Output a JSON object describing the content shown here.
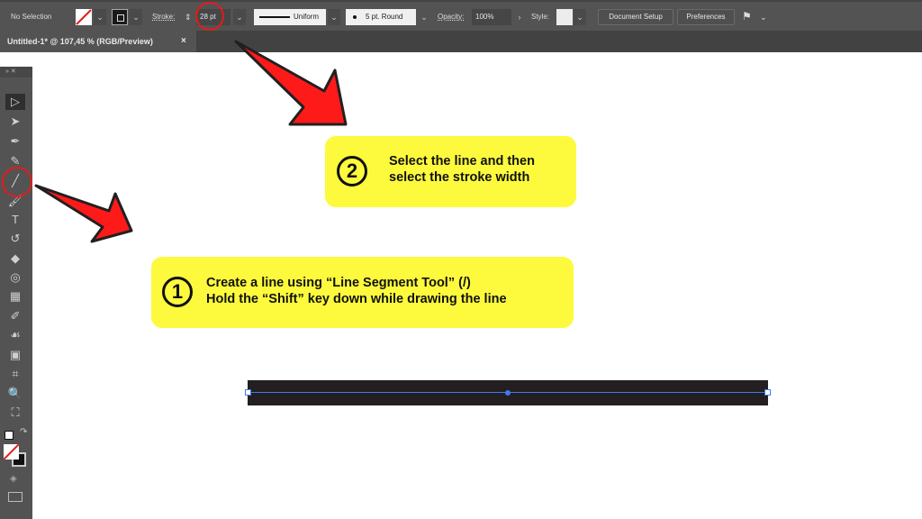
{
  "control_bar": {
    "selection_status": "No Selection",
    "stroke_label": "Stroke:",
    "stroke_value": "28 pt",
    "profile_label": "Uniform",
    "brush_label": "5 pt. Round",
    "opacity_label": "Opacity:",
    "opacity_value": "100%",
    "style_label": "Style:",
    "document_setup_button": "Document Setup",
    "preferences_button": "Preferences"
  },
  "document_tab": {
    "title": "Untitled-1* @ 107,45 % (RGB/Preview)",
    "close": "×"
  },
  "toolbar": {
    "header": "» ✕",
    "tools": [
      {
        "name": "selection-tool",
        "glyph": "▷"
      },
      {
        "name": "direct-selection-tool",
        "glyph": "➤"
      },
      {
        "name": "pen-tool",
        "glyph": "✒"
      },
      {
        "name": "curvature-tool",
        "glyph": "✎"
      },
      {
        "name": "line-segment-tool",
        "glyph": "╱"
      },
      {
        "name": "paintbrush-tool",
        "glyph": "🖌"
      },
      {
        "name": "type-tool",
        "glyph": "T"
      },
      {
        "name": "rotate-tool",
        "glyph": "↺"
      },
      {
        "name": "eraser-tool",
        "glyph": "◆"
      },
      {
        "name": "shape-builder-tool",
        "glyph": "◎"
      },
      {
        "name": "gradient-tool",
        "glyph": "▦"
      },
      {
        "name": "eyedropper-tool",
        "glyph": "✐"
      },
      {
        "name": "puppet-warp-tool",
        "glyph": "☙"
      },
      {
        "name": "live-paint-tool",
        "glyph": "▣"
      },
      {
        "name": "artboard-tool",
        "glyph": "⌗"
      },
      {
        "name": "zoom-tool",
        "glyph": "🔍"
      },
      {
        "name": "free-transform-tool",
        "glyph": "⛶"
      }
    ]
  },
  "callouts": {
    "step1": {
      "number": "1",
      "line1": "Create a line using “Line Segment Tool” (/)",
      "line2": "Hold the “Shift” key down while drawing the line"
    },
    "step2": {
      "number": "2",
      "line1": "Select the line and then",
      "line2": "select the stroke width"
    }
  },
  "colors": {
    "callout_bg": "#fdfa3d",
    "arrow_red": "#ff1a1a",
    "highlight_circle": "#e51b1b",
    "selection_blue": "#3d7bf0",
    "line_stroke": "#231f20"
  }
}
